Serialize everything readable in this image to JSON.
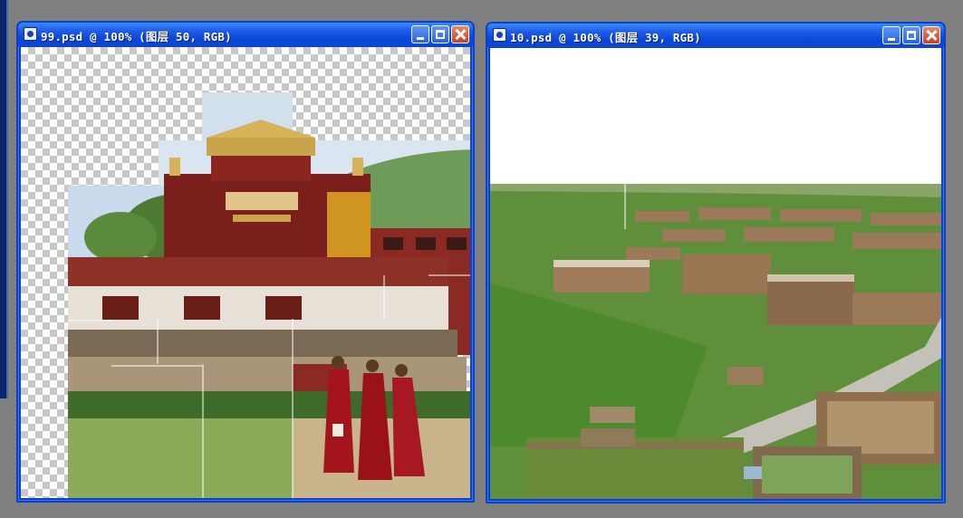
{
  "windows": [
    {
      "title": "99.psd @ 100% (图层 50, RGB)",
      "buttons": {
        "minimize": "minimize",
        "maximize": "maximize",
        "close": "close"
      }
    },
    {
      "title": "10.psd @ 100% (图层 39, RGB)",
      "buttons": {
        "minimize": "minimize",
        "maximize": "maximize",
        "close": "close"
      }
    }
  ],
  "colors": {
    "titlebar": "#0a46d8",
    "desktop": "#7f7f7f",
    "sky": "#c6d9ea",
    "grass": "#6f9a3e",
    "monk_robe": "#a3141c",
    "wall_red": "#8a2a22",
    "roof_gold": "#c9a44a"
  },
  "icons": [
    "photoshop-document-icon",
    "minimize-icon",
    "maximize-icon",
    "close-icon"
  ]
}
